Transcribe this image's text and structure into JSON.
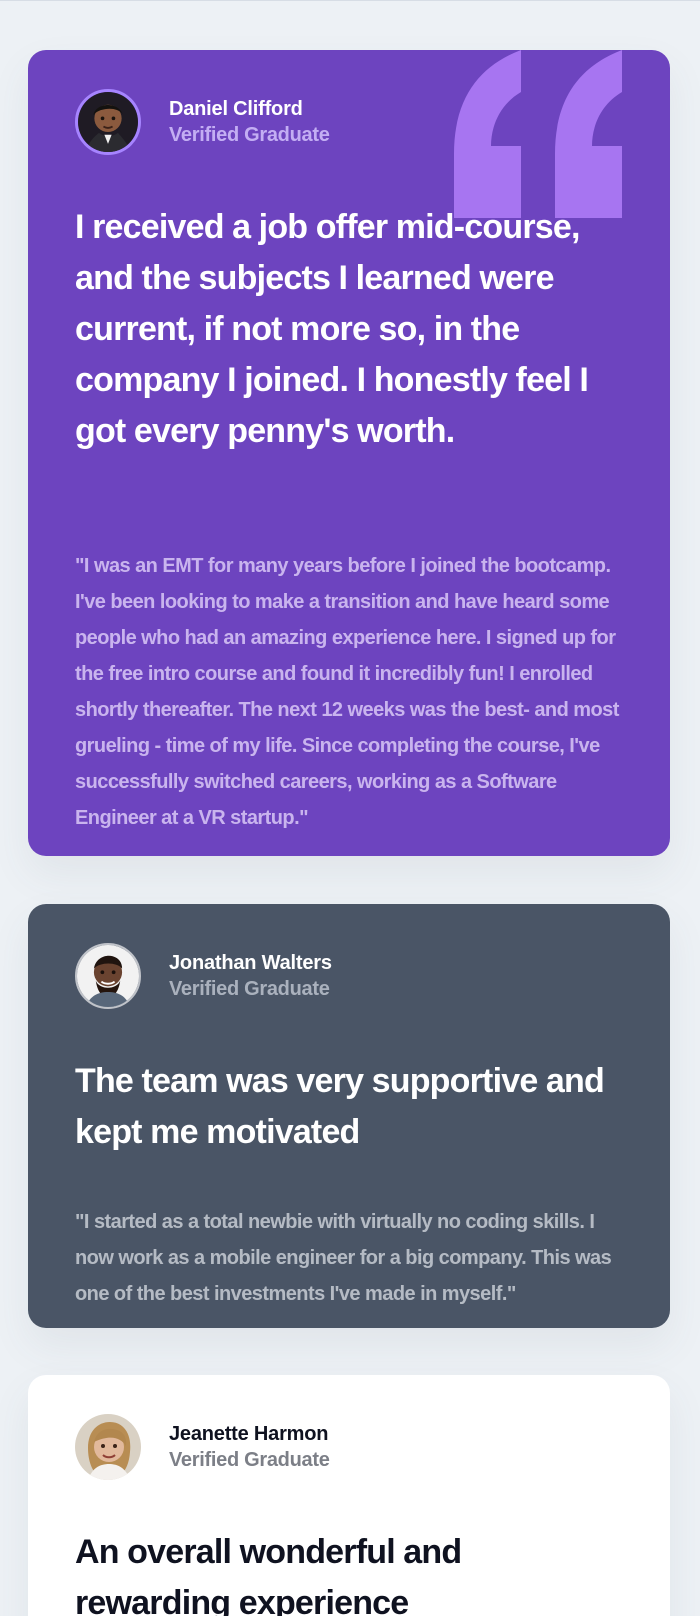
{
  "testimonials": [
    {
      "name": "Daniel Clifford",
      "status": "Verified Graduate",
      "headline": "I received a job offer mid-course, and the subjects I learned were current, if not more so, in the company I joined. I honestly feel I got every penny's worth.",
      "quote": "\"I was an EMT for many years before I joined the bootcamp. I've been looking to make a transition and have heard some people who had an amazing experience here. I signed up for the free intro course and found it incredibly fun! I enrolled shortly thereafter. The next 12 weeks was the best- and most grueling - time of my life. Since completing the course, I've successfully switched careers, working as a Software Engineer at a VR startup.\"",
      "icon": "quotation-mark-icon",
      "accent": "#6d44bf"
    },
    {
      "name": "Jonathan Walters",
      "status": "Verified Graduate",
      "headline": "The team was very supportive and kept me motivated",
      "quote": "\"I started as a total newbie with virtually no coding skills. I now work as a mobile engineer for a big company. This was one of the best investments I've made in myself.\"",
      "accent": "#4a5566"
    },
    {
      "name": "Jeanette Harmon",
      "status": "Verified Graduate",
      "headline": "An overall wonderful and rewarding experience",
      "accent": "#ffffff"
    }
  ],
  "colors": {
    "page_background": "#edf1f5",
    "purple_card": "#6d44bf",
    "slate_card": "#4a5566",
    "white_card": "#ffffff",
    "quote_mark": "#a775f1"
  }
}
